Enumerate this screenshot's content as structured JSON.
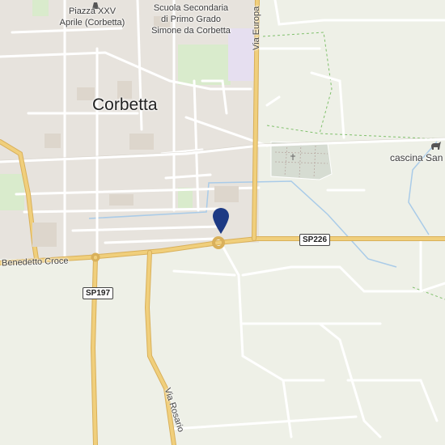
{
  "map": {
    "place_labels": {
      "piazza_line1": "Piazza XXV",
      "piazza_line2": "Aprile (Corbetta)",
      "school_line1": "Scuola Secondaria",
      "school_line2": "di Primo Grado",
      "school_line3": "Simone da Corbetta",
      "town": "Corbetta",
      "cascina": "cascina San"
    },
    "road_labels": {
      "via_europa": "Via Europa",
      "benedetto": "Benedetto Croce",
      "via_rosario": "Via Rosario"
    },
    "shields": {
      "sp226": "SP226",
      "sp197": "SP197"
    },
    "colors": {
      "background": "#eef0e7",
      "urban": "#e7e3dd",
      "park": "#d9ebcc",
      "school": "#e6dff0",
      "major_road": "#f0cf7c",
      "minor_road": "#ffffff",
      "water": "#a9cbe8",
      "boundary": "#7fc06b",
      "pin": "#1d3a84"
    },
    "icons": [
      "monument-icon",
      "cemetery-icon",
      "farm-icon",
      "location-pin-icon"
    ]
  }
}
